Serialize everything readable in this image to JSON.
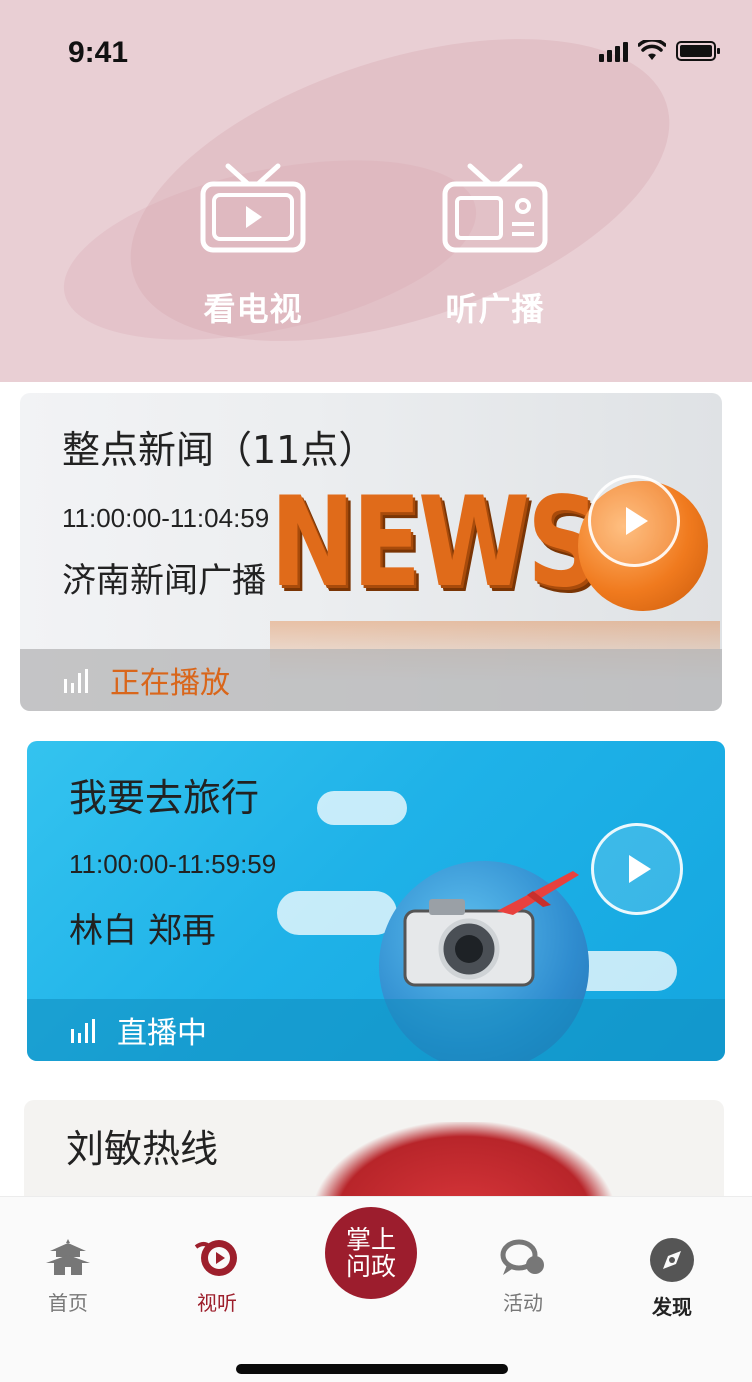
{
  "status_bar": {
    "time": "9:41"
  },
  "modes": {
    "tv_label": "看电视",
    "radio_label": "听广播"
  },
  "programs": [
    {
      "title": "整点新闻（11点）",
      "time": "11:00:00-11:04:59",
      "host": "济南新闻广播",
      "status": "正在播放",
      "status_color": "#d9661b",
      "banner_text": "NEWS"
    },
    {
      "title": "我要去旅行",
      "time": "11:00:00-11:59:59",
      "host": "林白 郑再",
      "status": "直播中",
      "status_color": "#ffffff"
    },
    {
      "title": "刘敏热线"
    }
  ],
  "tabbar": {
    "home": "首页",
    "listen": "视听",
    "center_line1": "掌上",
    "center_line2": "问政",
    "activity": "活动",
    "discover": "发现"
  },
  "colors": {
    "brand": "#9c1d2d",
    "header_bg": "#e9cfd4",
    "accent_orange": "#d9661b",
    "travel_blue": "#1fb2e8"
  }
}
